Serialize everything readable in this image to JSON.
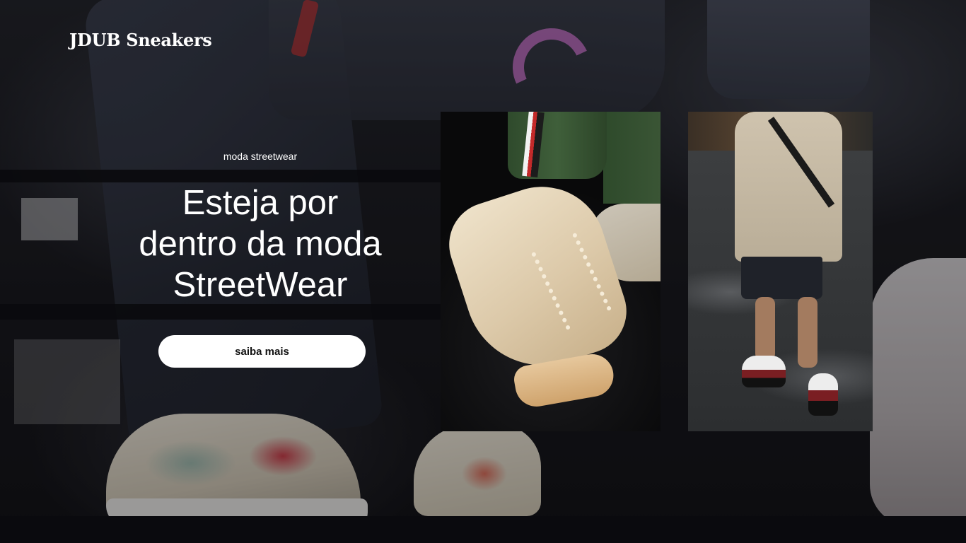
{
  "header": {
    "brand": "JDUB Sneakers"
  },
  "hero": {
    "eyebrow": "moda streetwear",
    "headline": "Esteja por\ndentro da moda\nStreetWear",
    "cta_label": "saiba mais"
  },
  "colors": {
    "text": "#ffffff",
    "cta_background": "#ffffff",
    "cta_text": "#111111"
  }
}
